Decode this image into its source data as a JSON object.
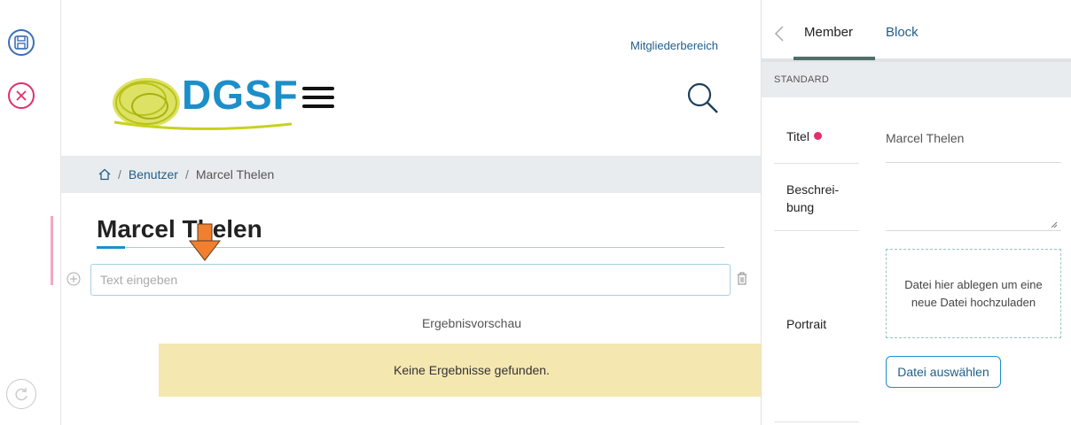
{
  "toolbar": {
    "save_icon": "save-icon",
    "close_icon": "close-icon",
    "redo_icon": "redo-icon",
    "colors": {
      "save": "#3b6fb6",
      "close": "#e0306a",
      "redo": "#c8c8c8"
    }
  },
  "site": {
    "member_link": "Mitgliederbereich",
    "logo_text": "DGSF",
    "breadcrumb": {
      "home_icon": "home-icon",
      "sep1": "/",
      "link": "Benutzer",
      "sep2": "/",
      "current": "Marcel Thelen"
    },
    "page_title": "Marcel Thelen",
    "text_input": {
      "placeholder": "Text eingeben",
      "value": ""
    },
    "preview_label": "Ergebnisvorschau",
    "no_results": "Keine Ergebnisse gefunden.",
    "colors": {
      "accent": "#1c8fc8",
      "logo_scribble": "#c8d21e",
      "notice_bg": "#f5e7b0",
      "drag_arrow": "#f08030"
    }
  },
  "panel": {
    "tabs": {
      "back_icon": "chevron-left-icon",
      "member": "Member",
      "block": "Block"
    },
    "section": "STANDARD",
    "fields": {
      "title_label": "Titel",
      "title_value": "Marcel Thelen",
      "desc_label_1": "Beschrei-",
      "desc_label_2": "bung",
      "desc_value": "",
      "portrait_label": "Portrait",
      "dropzone_text": "Datei hier ablegen um eine neue Datei hochzuladen",
      "file_button": "Datei auswählen"
    },
    "colors": {
      "required_dot": "#e0306a",
      "tab_underline": "#4e6e6a",
      "dropzone_border": "#9cc3c0"
    }
  }
}
